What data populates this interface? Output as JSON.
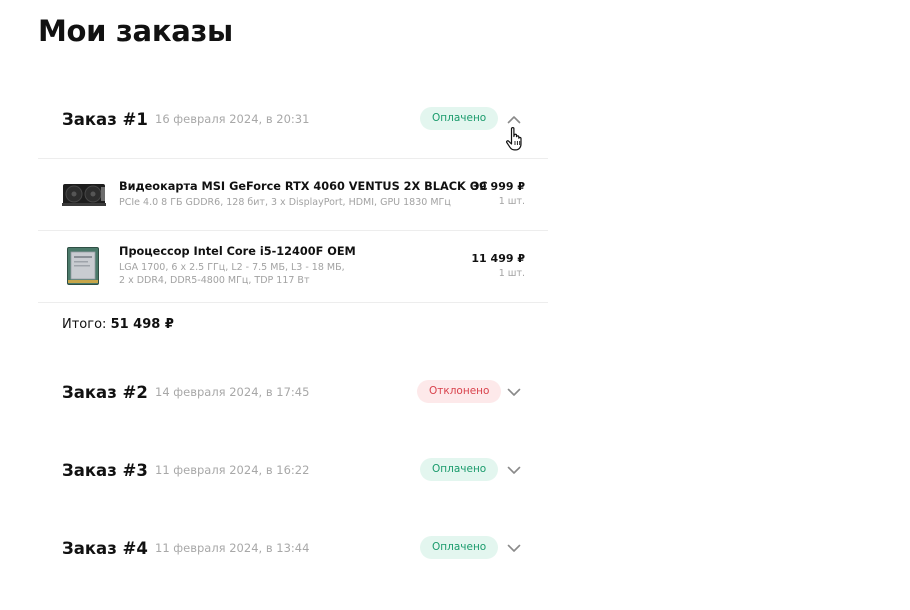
{
  "page": {
    "title": "Мои заказы"
  },
  "orders": [
    {
      "title": "Заказ #1",
      "date": "16 февраля 2024, в 20:31",
      "status": "Оплачено",
      "status_type": "paid",
      "expanded": true,
      "chevron_icon": "chevron-up-icon",
      "items": [
        {
          "name": "Видеокарта MSI GeForce RTX 4060 VENTUS 2X BLACK OC",
          "spec_lines": [
            "PCIe 4.0 8 ГБ GDDR6, 128 бит, 3 x DisplayPort, HDMI, GPU 1830 МГц"
          ],
          "price": "39 999 ₽",
          "qty": "1 шт.",
          "image_icon": "graphics-card-image"
        },
        {
          "name": "Процессор Intel Core i5-12400F OEM",
          "spec_lines": [
            "LGA 1700, 6 x 2.5 ГГц, L2 - 7.5 МБ, L3 - 18 МБ,",
            "2 x DDR4, DDR5-4800 МГц, TDP 117 Вт"
          ],
          "price": "11 499 ₽",
          "qty": "1 шт.",
          "image_icon": "cpu-image"
        }
      ],
      "total_label": "Итого:",
      "total_value": "51 498 ₽"
    },
    {
      "title": "Заказ #2",
      "date": "14 февраля 2024, в 17:45",
      "status": "Отклонено",
      "status_type": "rejected",
      "expanded": false,
      "chevron_icon": "chevron-down-icon"
    },
    {
      "title": "Заказ #3",
      "date": "11 февраля 2024, в 16:22",
      "status": "Оплачено",
      "status_type": "paid",
      "expanded": false,
      "chevron_icon": "chevron-down-icon"
    },
    {
      "title": "Заказ #4",
      "date": "11 февраля 2024, в 13:44",
      "status": "Оплачено",
      "status_type": "paid",
      "expanded": false,
      "chevron_icon": "chevron-down-icon"
    }
  ],
  "colors": {
    "paid_bg": "#e3f6ef",
    "paid_text": "#1a9b6c",
    "rejected_bg": "#fde9ea",
    "rejected_text": "#d9424c"
  }
}
